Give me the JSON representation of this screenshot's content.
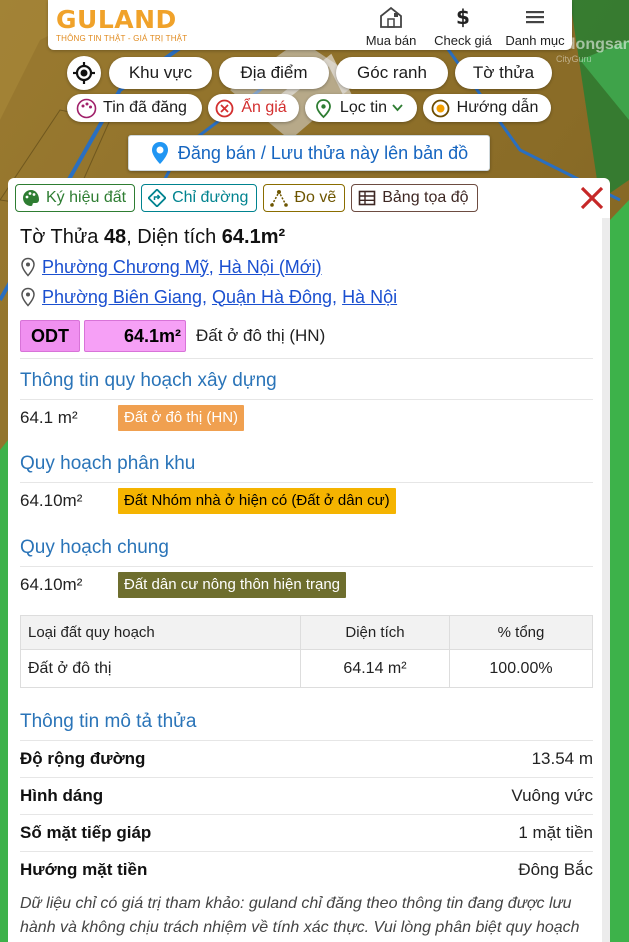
{
  "header": {
    "logo_text": "GULAND",
    "logo_tagline": "THÔNG TIN THẬT - GIÁ TRỊ THẬT",
    "nav": [
      {
        "label": "Mua bán",
        "icon": "house-icon"
      },
      {
        "label": "Check giá",
        "icon": "dollar-icon"
      },
      {
        "label": "Danh mục",
        "icon": "menu-icon"
      }
    ],
    "watermark": "Batdongsan",
    "watermark_sub": "CityGuru"
  },
  "map_buttons": {
    "row1": [
      "Khu vực",
      "Địa điểm",
      "Góc ranh",
      "Tờ thửa"
    ],
    "row2": [
      "Tin đã đăng",
      "Ẩn giá",
      "Lọc tin",
      "Hướng dẫn"
    ]
  },
  "post_button": "Đăng bán / Lưu thửa này lên bản đồ",
  "tools": [
    "Ký hiệu đất",
    "Chỉ đường",
    "Đo vẽ",
    "Bảng tọa độ"
  ],
  "parcel": {
    "title_prefix": "Tờ Thửa ",
    "sheet": "48",
    "title_mid": ", Diện tích ",
    "area": "64.1m²",
    "address1": {
      "ward": "Phường Chương Mỹ",
      "city": "Hà Nội (Mới)"
    },
    "address2": {
      "ward": "Phường Biên Giang",
      "district": "Quận Hà Đông",
      "city": "Hà Nội"
    },
    "zone_code": "ODT",
    "zone_area": "64.1m²",
    "zone_desc": "Đất ở đô thị (HN)"
  },
  "sections": [
    {
      "heading": "Thông tin quy hoạch xây dựng",
      "value": "64.1 m²",
      "tag": "Đất ở đô thị (HN)"
    },
    {
      "heading": "Quy hoạch phân khu",
      "value": "64.10m²",
      "tag": "Đất Nhóm nhà ở hiện có (Đất ở dân cư)"
    },
    {
      "heading": "Quy hoạch chung",
      "value": "64.10m²",
      "tag": "Đất dân cư nông thôn hiện trạng"
    }
  ],
  "table": {
    "headers": [
      "Loại đất quy hoạch",
      "Diện tích",
      "% tổng"
    ],
    "rows": [
      [
        "Đất ở đô thị",
        "64.14 m²",
        "100.00%"
      ]
    ]
  },
  "description": {
    "heading": "Thông tin mô tả thửa",
    "rows": [
      {
        "k": "Độ rộng đường",
        "v": "13.54 m"
      },
      {
        "k": "Hình dáng",
        "v": "Vuông vức"
      },
      {
        "k": "Số mặt tiếp giáp",
        "v": "1 mặt tiền"
      },
      {
        "k": "Hướng mặt tiền",
        "v": "Đông Bắc"
      }
    ],
    "note": "Dữ liệu chỉ có giá trị tham khảo: guland chỉ đăng theo thông tin đang được lưu hành và không chịu trách nhiệm về tính xác thực. Vui lòng phân biệt quy hoạch theo màu và kí hiệu đất trên từng loại bản đồ. Hãy kiểm tra và xác thực lại với cơ"
  },
  "colors": {
    "accent": "#2a74b8",
    "link": "#1a4fd0",
    "close": "#c62828"
  }
}
